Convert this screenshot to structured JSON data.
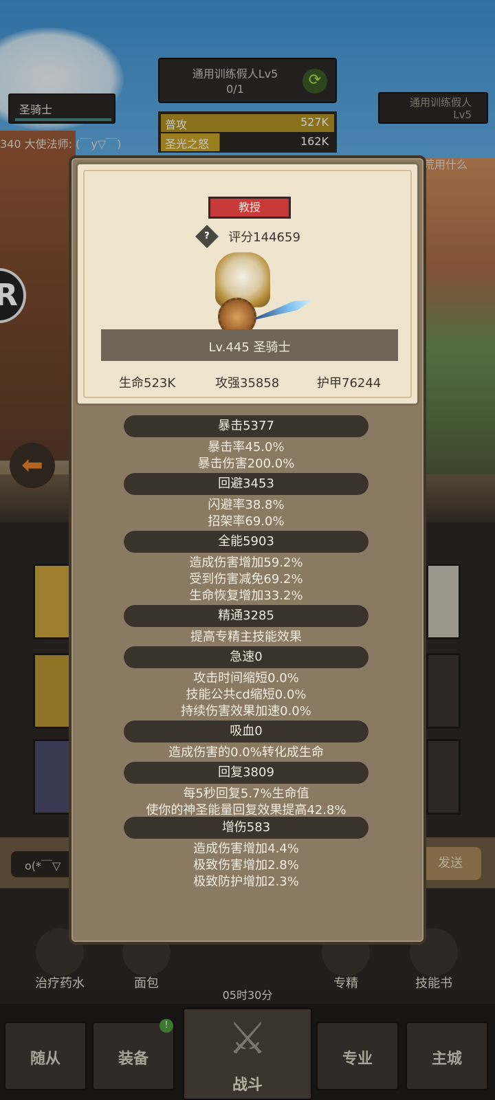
{
  "background": {
    "player_name": "圣骑士",
    "target": {
      "name": "通用训练假人Lv5",
      "progress": "0/1",
      "swap_icon": "refresh-icon"
    },
    "target_right": {
      "line1": "通用训练假人",
      "line2": "Lv5"
    },
    "damage": [
      {
        "label": "普攻",
        "value": "527K"
      },
      {
        "label": "圣光之怒",
        "value": "162K"
      }
    ],
    "chat_left": "340 大使法师: (￣y▽￣)",
    "chat_right": "荒用什么",
    "circle_glyph": "R",
    "chat_input": "o(*￣▽",
    "send_label": "发送",
    "quickbar": [
      "治疗药水",
      "面包",
      "专精",
      "技能书"
    ],
    "timer": "05时30分",
    "nav": {
      "items": [
        "随从",
        "装备",
        "专业",
        "主城"
      ],
      "battle": "战斗",
      "badge": "!"
    }
  },
  "modal": {
    "rank": "教授",
    "score": "评分144659",
    "level_title": "Lv.445 圣骑士",
    "basic_stats": [
      "生命523K",
      "攻强35858",
      "护甲76244"
    ],
    "sections": [
      {
        "title": "暴击5377",
        "lines": [
          "暴击率45.0%",
          "暴击伤害200.0%"
        ]
      },
      {
        "title": "回避3453",
        "lines": [
          "闪避率38.8%",
          "招架率69.0%"
        ]
      },
      {
        "title": "全能5903",
        "lines": [
          "造成伤害增加59.2%",
          "受到伤害减免69.2%",
          "生命恢复增加33.2%"
        ]
      },
      {
        "title": "精通3285",
        "lines": [
          "提高专精主技能效果"
        ]
      },
      {
        "title": "急速0",
        "lines": [
          "攻击时间缩短0.0%",
          "技能公共cd缩短0.0%",
          "持续伤害效果加速0.0%"
        ]
      },
      {
        "title": "吸血0",
        "lines": [
          "造成伤害的0.0%转化成生命"
        ]
      },
      {
        "title": "回复3809",
        "lines": [
          "每5秒回复5.7%生命值",
          "使你的神圣能量回复效果提高42.8%"
        ]
      },
      {
        "title": "增伤583",
        "lines": [
          "造成伤害增加4.4%",
          "极致伤害增加2.8%",
          "极致防护增加2.3%"
        ]
      }
    ]
  }
}
